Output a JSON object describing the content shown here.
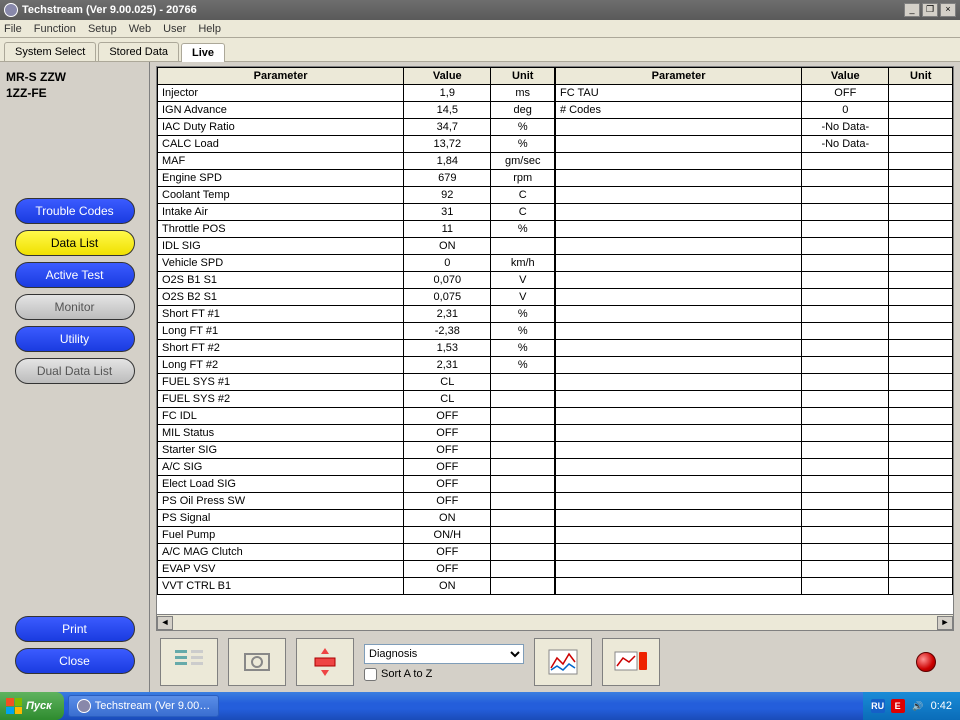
{
  "window": {
    "title": "Techstream (Ver 9.00.025) - 20766"
  },
  "menubar": [
    "File",
    "Function",
    "Setup",
    "Web",
    "User",
    "Help"
  ],
  "tabs": [
    {
      "label": "System Select",
      "active": false
    },
    {
      "label": "Stored Data",
      "active": false
    },
    {
      "label": "Live",
      "active": true
    }
  ],
  "vehicle": {
    "line1": "MR-S ZZW",
    "line2": "1ZZ-FE"
  },
  "sidebuttons": [
    {
      "label": "Trouble Codes",
      "style": "blue"
    },
    {
      "label": "Data List",
      "style": "yellow"
    },
    {
      "label": "Active Test",
      "style": "blue"
    },
    {
      "label": "Monitor",
      "style": "grey"
    },
    {
      "label": "Utility",
      "style": "blue"
    },
    {
      "label": "Dual Data List",
      "style": "grey"
    }
  ],
  "bottom_buttons": [
    {
      "label": "Print",
      "style": "blue"
    },
    {
      "label": "Close",
      "style": "blue"
    }
  ],
  "table_headers": {
    "param": "Parameter",
    "value": "Value",
    "unit": "Unit"
  },
  "left_rows": [
    {
      "param": "Injector",
      "value": "1,9",
      "unit": "ms"
    },
    {
      "param": "IGN Advance",
      "value": "14,5",
      "unit": "deg"
    },
    {
      "param": "IAC Duty Ratio",
      "value": "34,7",
      "unit": "%"
    },
    {
      "param": "CALC Load",
      "value": "13,72",
      "unit": "%"
    },
    {
      "param": "MAF",
      "value": "1,84",
      "unit": "gm/sec"
    },
    {
      "param": "Engine SPD",
      "value": "679",
      "unit": "rpm"
    },
    {
      "param": "Coolant Temp",
      "value": "92",
      "unit": "C"
    },
    {
      "param": "Intake Air",
      "value": "31",
      "unit": "C"
    },
    {
      "param": "Throttle POS",
      "value": "11",
      "unit": "%"
    },
    {
      "param": "IDL SIG",
      "value": "ON",
      "unit": ""
    },
    {
      "param": "Vehicle SPD",
      "value": "0",
      "unit": "km/h"
    },
    {
      "param": "O2S B1 S1",
      "value": "0,070",
      "unit": "V"
    },
    {
      "param": "O2S B2 S1",
      "value": "0,075",
      "unit": "V"
    },
    {
      "param": "Short FT #1",
      "value": "2,31",
      "unit": "%"
    },
    {
      "param": "Long FT #1",
      "value": "-2,38",
      "unit": "%"
    },
    {
      "param": "Short FT #2",
      "value": "1,53",
      "unit": "%"
    },
    {
      "param": "Long FT #2",
      "value": "2,31",
      "unit": "%"
    },
    {
      "param": "FUEL SYS #1",
      "value": "CL",
      "unit": ""
    },
    {
      "param": "FUEL SYS #2",
      "value": "CL",
      "unit": ""
    },
    {
      "param": "FC IDL",
      "value": "OFF",
      "unit": ""
    },
    {
      "param": "MIL Status",
      "value": "OFF",
      "unit": ""
    },
    {
      "param": "Starter SIG",
      "value": "OFF",
      "unit": ""
    },
    {
      "param": "A/C SIG",
      "value": "OFF",
      "unit": ""
    },
    {
      "param": "Elect Load SIG",
      "value": "OFF",
      "unit": ""
    },
    {
      "param": "PS Oil Press SW",
      "value": "OFF",
      "unit": ""
    },
    {
      "param": "PS Signal",
      "value": "ON",
      "unit": ""
    },
    {
      "param": "Fuel Pump",
      "value": "ON/H",
      "unit": ""
    },
    {
      "param": "A/C MAG Clutch",
      "value": "OFF",
      "unit": ""
    },
    {
      "param": "EVAP VSV",
      "value": "OFF",
      "unit": ""
    },
    {
      "param": "VVT CTRL B1",
      "value": "ON",
      "unit": ""
    }
  ],
  "right_rows": [
    {
      "param": "FC TAU",
      "value": "OFF",
      "unit": ""
    },
    {
      "param": "# Codes",
      "value": "0",
      "unit": ""
    },
    {
      "param": "",
      "value": "-No Data-",
      "unit": ""
    },
    {
      "param": "",
      "value": "-No Data-",
      "unit": ""
    }
  ],
  "right_blank_rows": 26,
  "toolbar": {
    "diagnosis_select": "Diagnosis",
    "sort_label": "Sort A to Z"
  },
  "taskbar": {
    "start": "Пуск",
    "task": "Techstream (Ver 9.00…",
    "lang": "RU",
    "clock": "0:42"
  }
}
